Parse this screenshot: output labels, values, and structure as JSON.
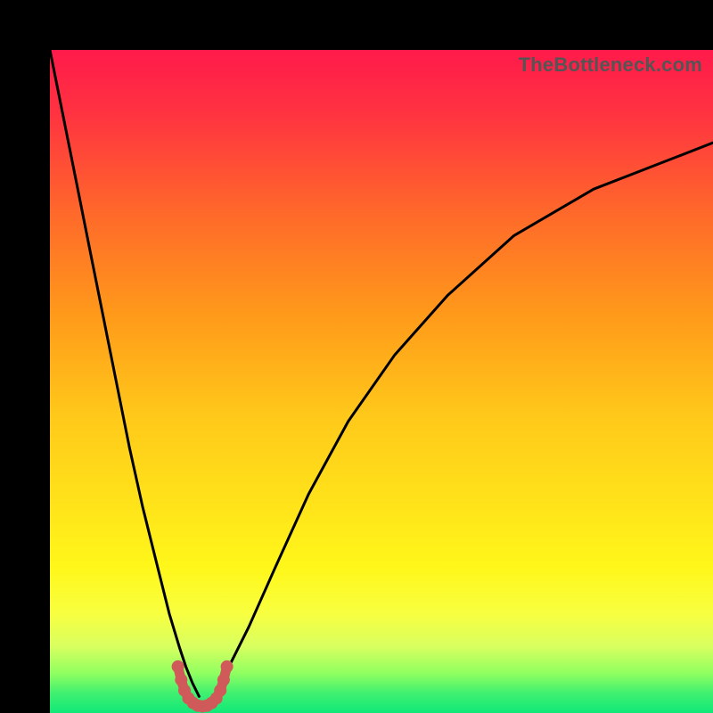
{
  "watermark": "TheBottleneck.com",
  "chart_data": {
    "type": "line",
    "title": "",
    "xlabel": "",
    "ylabel": "",
    "xlim": [
      0,
      100
    ],
    "ylim": [
      0,
      100
    ],
    "trough_x": 23,
    "gradient_stops": [
      {
        "offset": 0.0,
        "color": "#ff1a4b"
      },
      {
        "offset": 0.1,
        "color": "#ff3440"
      },
      {
        "offset": 0.25,
        "color": "#ff6a2a"
      },
      {
        "offset": 0.4,
        "color": "#ff9a1a"
      },
      {
        "offset": 0.55,
        "color": "#ffc81a"
      },
      {
        "offset": 0.7,
        "color": "#ffe61a"
      },
      {
        "offset": 0.78,
        "color": "#fff71a"
      },
      {
        "offset": 0.85,
        "color": "#f8ff40"
      },
      {
        "offset": 0.9,
        "color": "#d8ff60"
      },
      {
        "offset": 0.94,
        "color": "#90ff60"
      },
      {
        "offset": 0.97,
        "color": "#40f070"
      },
      {
        "offset": 1.0,
        "color": "#10e878"
      }
    ],
    "series": [
      {
        "name": "curve-left",
        "x": [
          0,
          2,
          4,
          6,
          8,
          10,
          12,
          14,
          16,
          18,
          19.5,
          20.5,
          21.5,
          22.5
        ],
        "y": [
          100,
          90,
          80,
          70,
          60,
          50,
          40,
          31,
          23,
          15,
          10,
          7,
          4.5,
          2.5
        ]
      },
      {
        "name": "curve-right",
        "x": [
          25,
          27,
          30,
          34,
          39,
          45,
          52,
          60,
          70,
          82,
          100
        ],
        "y": [
          3,
          7,
          13,
          22,
          33,
          44,
          54,
          63,
          72,
          79,
          86
        ]
      }
    ],
    "markers": {
      "name": "threshold-dots",
      "color": "#d05a5a",
      "points": [
        {
          "x": 19.3,
          "y": 7.0
        },
        {
          "x": 19.8,
          "y": 5.0
        },
        {
          "x": 20.3,
          "y": 3.4
        },
        {
          "x": 20.9,
          "y": 2.2
        },
        {
          "x": 21.6,
          "y": 1.5
        },
        {
          "x": 22.3,
          "y": 1.1
        },
        {
          "x": 23.0,
          "y": 1.0
        },
        {
          "x": 23.7,
          "y": 1.1
        },
        {
          "x": 24.4,
          "y": 1.5
        },
        {
          "x": 25.1,
          "y": 2.2
        },
        {
          "x": 25.7,
          "y": 3.4
        },
        {
          "x": 26.2,
          "y": 5.0
        },
        {
          "x": 26.7,
          "y": 7.0
        }
      ]
    }
  }
}
